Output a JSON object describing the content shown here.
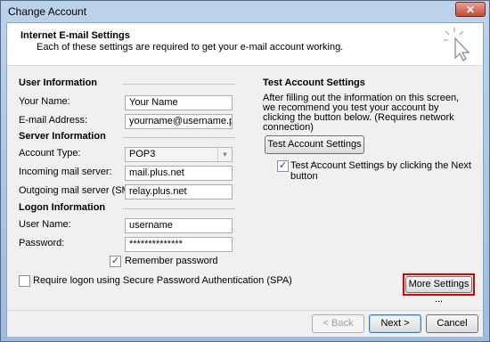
{
  "window": {
    "title": "Change Account",
    "close_label": "✕"
  },
  "header": {
    "title": "Internet E-mail Settings",
    "description": "Each of these settings are required to get your e-mail account working."
  },
  "user_info": {
    "section_title": "User Information",
    "name_label": "Your Name:",
    "name_value": "Your Name",
    "email_label": "E-mail Address:",
    "email_value": "yourname@username.plus.com"
  },
  "server_info": {
    "section_title": "Server Information",
    "account_type_label": "Account Type:",
    "account_type_value": "POP3",
    "incoming_label": "Incoming mail server:",
    "incoming_value": "mail.plus.net",
    "outgoing_label": "Outgoing mail server (SMTP):",
    "outgoing_value": "relay.plus.net"
  },
  "logon_info": {
    "section_title": "Logon Information",
    "username_label": "User Name:",
    "username_value": "username",
    "password_label": "Password:",
    "password_value": "**************",
    "remember_label": "Remember password",
    "remember_checked": true,
    "spa_label": "Require logon using Secure Password Authentication (SPA)",
    "spa_checked": false
  },
  "test_settings": {
    "section_title": "Test Account Settings",
    "description": "After filling out the information on this screen, we recommend you test your account by clicking the button below. (Requires network connection)",
    "button_label": "Test Account Settings ...",
    "next_checkbox_label": "Test Account Settings by clicking the Next button",
    "next_checked": true
  },
  "more_settings_label": "More Settings ...",
  "footer": {
    "back_label": "< Back",
    "next_label": "Next >",
    "cancel_label": "Cancel"
  },
  "colors": {
    "highlight": "#e00000",
    "check": "#1c3f8f"
  }
}
